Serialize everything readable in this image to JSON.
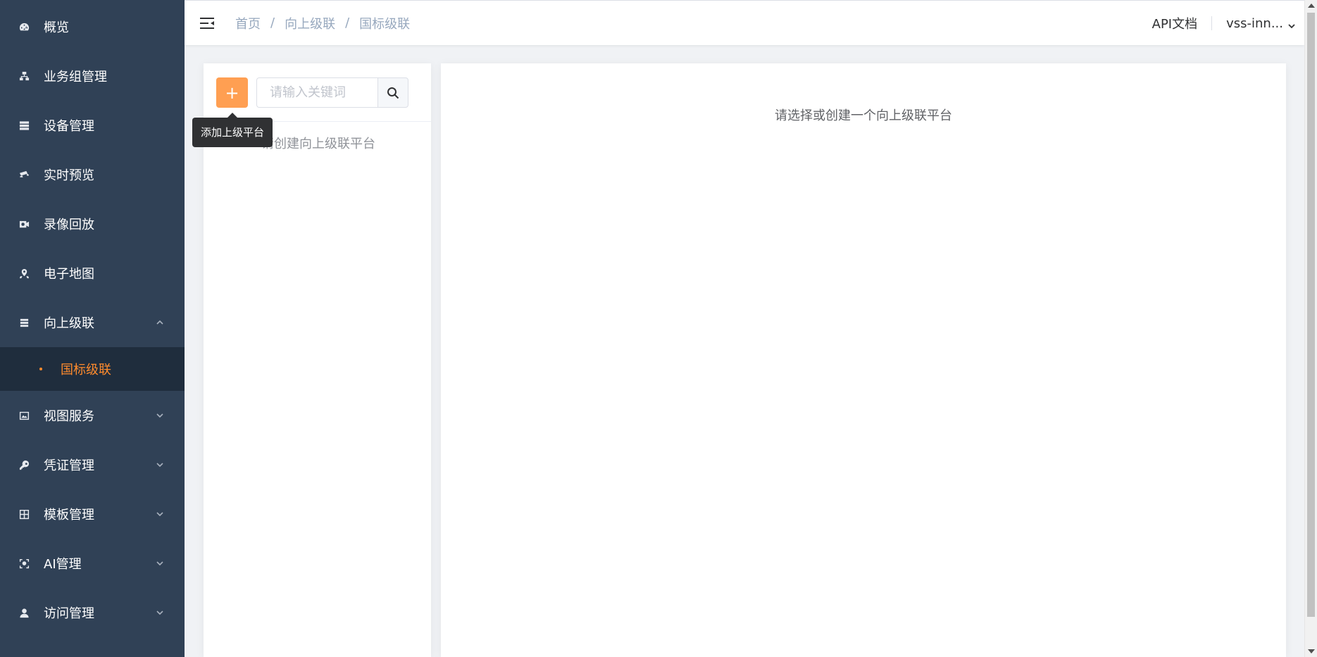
{
  "sidebar": {
    "items": [
      {
        "label": "概览",
        "icon": "dashboard-icon"
      },
      {
        "label": "业务组管理",
        "icon": "org-tree-icon"
      },
      {
        "label": "设备管理",
        "icon": "server-icon"
      },
      {
        "label": "实时预览",
        "icon": "camera-icon"
      },
      {
        "label": "录像回放",
        "icon": "video-record-icon"
      },
      {
        "label": "电子地图",
        "icon": "map-pin-icon"
      },
      {
        "label": "向上级联",
        "icon": "cascade-icon",
        "expanded": true
      },
      {
        "label": "视图服务",
        "icon": "image-icon"
      },
      {
        "label": "凭证管理",
        "icon": "key-icon"
      },
      {
        "label": "模板管理",
        "icon": "grid-icon"
      },
      {
        "label": "AI管理",
        "icon": "ai-scan-icon"
      },
      {
        "label": "访问管理",
        "icon": "user-icon"
      }
    ],
    "submenu": {
      "label": "国标级联",
      "active_color": "#ff8b2d"
    }
  },
  "header": {
    "breadcrumb": [
      "首页",
      "向上级联",
      "国标级联"
    ],
    "separator": "/",
    "api_doc": "API文档",
    "user": "vss-inn..."
  },
  "left_panel": {
    "add_button_label": "+",
    "search_placeholder": "请输入关键词",
    "empty_text": "请创建向上级联平台",
    "tooltip": "添加上级平台"
  },
  "right_panel": {
    "empty_text": "请选择或创建一个向上级联平台"
  },
  "colors": {
    "sidebar_bg": "#304156",
    "submenu_bg": "#1f2d3d",
    "accent": "#ff9f52",
    "page_bg": "#f0f2f5"
  }
}
